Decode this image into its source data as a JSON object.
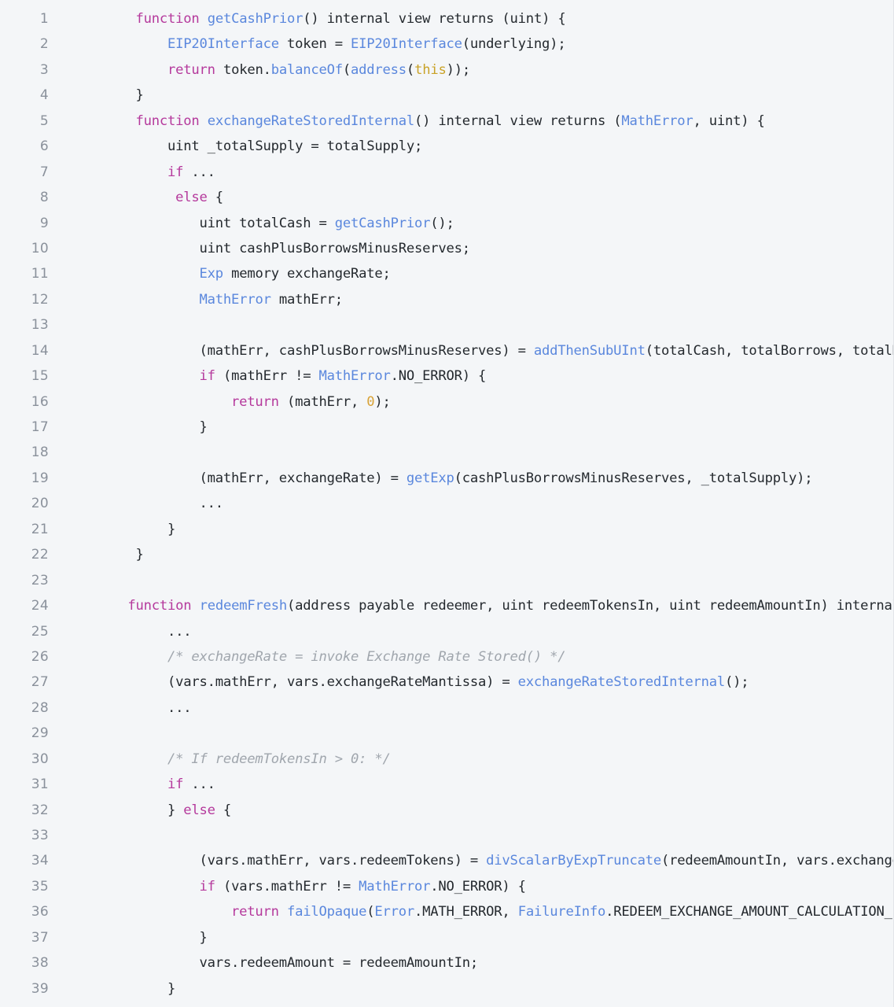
{
  "editor": {
    "name": "code-viewer",
    "language": "solidity",
    "background_color": "#f4f6f8",
    "text_color": "#24292e",
    "gutter_color": "#8a919b",
    "colors": {
      "keyword": "#b5399c",
      "function": "#5a87dd",
      "type": "#5a87dd",
      "number": "#d8a236",
      "literal": "#c9a227",
      "comment": "#a0a6ad",
      "plain": "#24292e"
    },
    "first_line_number": 1,
    "last_line_number": 39,
    "total_lines": 39
  },
  "lines": [
    {
      "n": "1",
      "tokens": [
        {
          "t": "    ",
          "c": "tok-plain"
        },
        {
          "t": "function",
          "c": "tok-kw"
        },
        {
          "t": " ",
          "c": "tok-plain"
        },
        {
          "t": "getCashPrior",
          "c": "tok-fn"
        },
        {
          "t": "() internal view returns (uint) {",
          "c": "tok-plain"
        }
      ]
    },
    {
      "n": "2",
      "tokens": [
        {
          "t": "        ",
          "c": "tok-plain"
        },
        {
          "t": "EIP20Interface",
          "c": "tok-type"
        },
        {
          "t": " token = ",
          "c": "tok-plain"
        },
        {
          "t": "EIP20Interface",
          "c": "tok-type"
        },
        {
          "t": "(underlying);",
          "c": "tok-plain"
        }
      ]
    },
    {
      "n": "3",
      "tokens": [
        {
          "t": "        ",
          "c": "tok-plain"
        },
        {
          "t": "return",
          "c": "tok-kw"
        },
        {
          "t": " token.",
          "c": "tok-plain"
        },
        {
          "t": "balanceOf",
          "c": "tok-fn"
        },
        {
          "t": "(",
          "c": "tok-plain"
        },
        {
          "t": "address",
          "c": "tok-type"
        },
        {
          "t": "(",
          "c": "tok-plain"
        },
        {
          "t": "this",
          "c": "tok-this"
        },
        {
          "t": "));",
          "c": "tok-plain"
        }
      ]
    },
    {
      "n": "4",
      "tokens": [
        {
          "t": "    }",
          "c": "tok-plain"
        }
      ]
    },
    {
      "n": "5",
      "tokens": [
        {
          "t": "    ",
          "c": "tok-plain"
        },
        {
          "t": "function",
          "c": "tok-kw"
        },
        {
          "t": " ",
          "c": "tok-plain"
        },
        {
          "t": "exchangeRateStoredInternal",
          "c": "tok-fn"
        },
        {
          "t": "() internal view returns (",
          "c": "tok-plain"
        },
        {
          "t": "MathError",
          "c": "tok-type"
        },
        {
          "t": ", uint) {",
          "c": "tok-plain"
        }
      ]
    },
    {
      "n": "6",
      "tokens": [
        {
          "t": "        uint _totalSupply = totalSupply;",
          "c": "tok-plain"
        }
      ]
    },
    {
      "n": "7",
      "tokens": [
        {
          "t": "        ",
          "c": "tok-plain"
        },
        {
          "t": "if",
          "c": "tok-kw"
        },
        {
          "t": " ...",
          "c": "tok-plain"
        }
      ]
    },
    {
      "n": "8",
      "tokens": [
        {
          "t": "         ",
          "c": "tok-plain"
        },
        {
          "t": "else",
          "c": "tok-kw"
        },
        {
          "t": " {",
          "c": "tok-plain"
        }
      ]
    },
    {
      "n": "9",
      "tokens": [
        {
          "t": "            uint totalCash = ",
          "c": "tok-plain"
        },
        {
          "t": "getCashPrior",
          "c": "tok-fn"
        },
        {
          "t": "();",
          "c": "tok-plain"
        }
      ]
    },
    {
      "n": "10",
      "tokens": [
        {
          "t": "            uint cashPlusBorrowsMinusReserves;",
          "c": "tok-plain"
        }
      ]
    },
    {
      "n": "11",
      "tokens": [
        {
          "t": "            ",
          "c": "tok-plain"
        },
        {
          "t": "Exp",
          "c": "tok-type"
        },
        {
          "t": " memory exchangeRate;",
          "c": "tok-plain"
        }
      ]
    },
    {
      "n": "12",
      "tokens": [
        {
          "t": "            ",
          "c": "tok-plain"
        },
        {
          "t": "MathError",
          "c": "tok-type"
        },
        {
          "t": " mathErr;",
          "c": "tok-plain"
        }
      ]
    },
    {
      "n": "13",
      "tokens": []
    },
    {
      "n": "14",
      "tokens": [
        {
          "t": "            (mathErr, cashPlusBorrowsMinusReserves) = ",
          "c": "tok-plain"
        },
        {
          "t": "addThenSubUInt",
          "c": "tok-fn"
        },
        {
          "t": "(totalCash, totalBorrows, totalReserves);",
          "c": "tok-plain"
        }
      ]
    },
    {
      "n": "15",
      "tokens": [
        {
          "t": "            ",
          "c": "tok-plain"
        },
        {
          "t": "if",
          "c": "tok-kw"
        },
        {
          "t": " (mathErr != ",
          "c": "tok-plain"
        },
        {
          "t": "MathError",
          "c": "tok-type"
        },
        {
          "t": ".NO_ERROR) {",
          "c": "tok-plain"
        }
      ]
    },
    {
      "n": "16",
      "tokens": [
        {
          "t": "                ",
          "c": "tok-plain"
        },
        {
          "t": "return",
          "c": "tok-kw"
        },
        {
          "t": " (mathErr, ",
          "c": "tok-plain"
        },
        {
          "t": "0",
          "c": "tok-num"
        },
        {
          "t": ");",
          "c": "tok-plain"
        }
      ]
    },
    {
      "n": "17",
      "tokens": [
        {
          "t": "            }",
          "c": "tok-plain"
        }
      ]
    },
    {
      "n": "18",
      "tokens": []
    },
    {
      "n": "19",
      "tokens": [
        {
          "t": "            (mathErr, exchangeRate) = ",
          "c": "tok-plain"
        },
        {
          "t": "getExp",
          "c": "tok-fn"
        },
        {
          "t": "(cashPlusBorrowsMinusReserves, _totalSupply);",
          "c": "tok-plain"
        }
      ]
    },
    {
      "n": "20",
      "tokens": [
        {
          "t": "            ...",
          "c": "tok-plain"
        }
      ]
    },
    {
      "n": "21",
      "tokens": [
        {
          "t": "        }",
          "c": "tok-plain"
        }
      ]
    },
    {
      "n": "22",
      "tokens": [
        {
          "t": "    }",
          "c": "tok-plain"
        }
      ]
    },
    {
      "n": "23",
      "tokens": []
    },
    {
      "n": "24",
      "tokens": [
        {
          "t": "   ",
          "c": "tok-plain"
        },
        {
          "t": "function",
          "c": "tok-kw"
        },
        {
          "t": " ",
          "c": "tok-plain"
        },
        {
          "t": "redeemFresh",
          "c": "tok-fn"
        },
        {
          "t": "(address payable redeemer, uint redeemTokensIn, uint redeemAmountIn) internal returns (uint) {",
          "c": "tok-plain"
        }
      ]
    },
    {
      "n": "25",
      "tokens": [
        {
          "t": "        ...",
          "c": "tok-plain"
        }
      ]
    },
    {
      "n": "26",
      "tokens": [
        {
          "t": "        ",
          "c": "tok-plain"
        },
        {
          "t": "/* exchangeRate = invoke Exchange Rate Stored() */",
          "c": "tok-cmt"
        }
      ]
    },
    {
      "n": "27",
      "tokens": [
        {
          "t": "        (vars.mathErr, vars.exchangeRateMantissa) = ",
          "c": "tok-plain"
        },
        {
          "t": "exchangeRateStoredInternal",
          "c": "tok-fn"
        },
        {
          "t": "();",
          "c": "tok-plain"
        }
      ]
    },
    {
      "n": "28",
      "tokens": [
        {
          "t": "        ...",
          "c": "tok-plain"
        }
      ]
    },
    {
      "n": "29",
      "tokens": []
    },
    {
      "n": "30",
      "tokens": [
        {
          "t": "        ",
          "c": "tok-plain"
        },
        {
          "t": "/* If redeemTokensIn > 0: */",
          "c": "tok-cmt"
        }
      ]
    },
    {
      "n": "31",
      "tokens": [
        {
          "t": "        ",
          "c": "tok-plain"
        },
        {
          "t": "if",
          "c": "tok-kw"
        },
        {
          "t": " ...",
          "c": "tok-plain"
        }
      ]
    },
    {
      "n": "32",
      "tokens": [
        {
          "t": "        } ",
          "c": "tok-plain"
        },
        {
          "t": "else",
          "c": "tok-kw"
        },
        {
          "t": " {",
          "c": "tok-plain"
        }
      ]
    },
    {
      "n": "33",
      "tokens": []
    },
    {
      "n": "34",
      "tokens": [
        {
          "t": "            (vars.mathErr, vars.redeemTokens) = ",
          "c": "tok-plain"
        },
        {
          "t": "divScalarByExpTruncate",
          "c": "tok-fn"
        },
        {
          "t": "(redeemAmountIn, vars.exchangeRate);",
          "c": "tok-plain"
        }
      ]
    },
    {
      "n": "35",
      "tokens": [
        {
          "t": "            ",
          "c": "tok-plain"
        },
        {
          "t": "if",
          "c": "tok-kw"
        },
        {
          "t": " (vars.mathErr != ",
          "c": "tok-plain"
        },
        {
          "t": "MathError",
          "c": "tok-type"
        },
        {
          "t": ".NO_ERROR) {",
          "c": "tok-plain"
        }
      ]
    },
    {
      "n": "36",
      "tokens": [
        {
          "t": "                ",
          "c": "tok-plain"
        },
        {
          "t": "return",
          "c": "tok-kw"
        },
        {
          "t": " ",
          "c": "tok-plain"
        },
        {
          "t": "failOpaque",
          "c": "tok-fn"
        },
        {
          "t": "(",
          "c": "tok-plain"
        },
        {
          "t": "Error",
          "c": "tok-type"
        },
        {
          "t": ".MATH_ERROR, ",
          "c": "tok-plain"
        },
        {
          "t": "FailureInfo",
          "c": "tok-type"
        },
        {
          "t": ".REDEEM_EXCHANGE_AMOUNT_CALCULATION_FAILED);",
          "c": "tok-plain"
        }
      ]
    },
    {
      "n": "37",
      "tokens": [
        {
          "t": "            }",
          "c": "tok-plain"
        }
      ]
    },
    {
      "n": "38",
      "tokens": [
        {
          "t": "            vars.redeemAmount = redeemAmountIn;",
          "c": "tok-plain"
        }
      ]
    },
    {
      "n": "39",
      "tokens": [
        {
          "t": "        }",
          "c": "tok-plain"
        }
      ]
    }
  ]
}
